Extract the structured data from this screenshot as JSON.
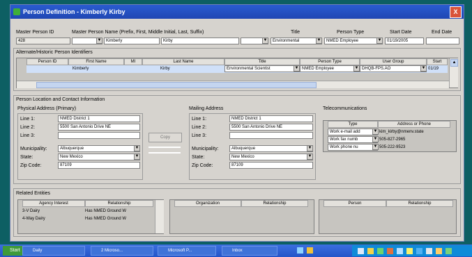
{
  "window": {
    "title": "Person Definition - Kimberly Kirby",
    "close_label": "X"
  },
  "master": {
    "labels": {
      "id": "Master Person ID",
      "name": "Master Person Name (Prefix, First, Middle Initial, Last, Suffix)",
      "title": "Title",
      "person_type": "Person Type",
      "start_date": "Start Date",
      "end_date": "End Date"
    },
    "values": {
      "id": "428",
      "prefix": "",
      "first": "Kimberly",
      "middle": "",
      "last": "Kirby",
      "suffix": "",
      "title": "Environmental",
      "person_type": "NMED Employee",
      "start_date": "01/19/2005",
      "end_date": ""
    }
  },
  "alternate": {
    "section_label": "Alternate/Historic Person Identifiers",
    "columns": [
      "Person ID",
      "First Name",
      "MI",
      "Last Name",
      "Title",
      "Person Type",
      "User Group",
      "Start"
    ],
    "row": {
      "person_id": "",
      "first_name": "Kimberly",
      "mi": "",
      "last_name": "Kirby",
      "title": "Environmental Scientist",
      "person_type": "NMED Employee",
      "user_group": "DHQB-FPS.AO",
      "start": "01/19"
    }
  },
  "location": {
    "section_label": "Person Location and Contact Information",
    "physical": {
      "heading": "Physical Address (Primary)",
      "labels": {
        "line1": "Line 1:",
        "line2": "Line 2:",
        "line3": "Line 3:",
        "municipality": "Municipality:",
        "state": "State:",
        "zip": "Zip Code:"
      },
      "line1": "NMED District 1",
      "line2": "5500 San Antonio Drive NE",
      "line3": "",
      "municipality": "Albuquerque",
      "state": "New Mexico",
      "zip": "87109"
    },
    "copy_button": "Copy",
    "mailing": {
      "heading": "Mailing Address",
      "labels": {
        "line1": "Line 1:",
        "line2": "Line 2:",
        "line3": "Line 3:",
        "municipality": "Municipality:",
        "state": "State:",
        "zip": "Zip Code:"
      },
      "line1": "NMED District 1",
      "line2": "5500 San Antonio Drive NE",
      "line3": "",
      "municipality": "Albuquerque",
      "state": "New Mexico",
      "zip": "87109"
    },
    "telecom": {
      "heading": "Telecommunications",
      "columns": [
        "Type",
        "Address or Phone"
      ],
      "rows": [
        {
          "type": "Work e-mail add",
          "value": "kim_kirby@nmenv.state"
        },
        {
          "type": "Work fax numb",
          "value": "505-827-2965"
        },
        {
          "type": "Work phone nu",
          "value": "505-222-9523"
        }
      ]
    }
  },
  "related": {
    "section_label": "Related Entities",
    "agency_columns": [
      "Agency Interest",
      "Relationship"
    ],
    "agency_rows": [
      {
        "agency": "3-V Dairy",
        "relationship": "Has NMED Ground W"
      },
      {
        "agency": "4-Way Dairy",
        "relationship": "Has NMED Ground W"
      }
    ],
    "org_columns": [
      "Organization",
      "Relationship"
    ],
    "person_columns": [
      "Person",
      "Relationship"
    ]
  },
  "taskbar": {
    "start_label": "Start",
    "items": [
      "Daily",
      "2 Microso...",
      "Microsoft P...",
      "Inbox"
    ]
  }
}
